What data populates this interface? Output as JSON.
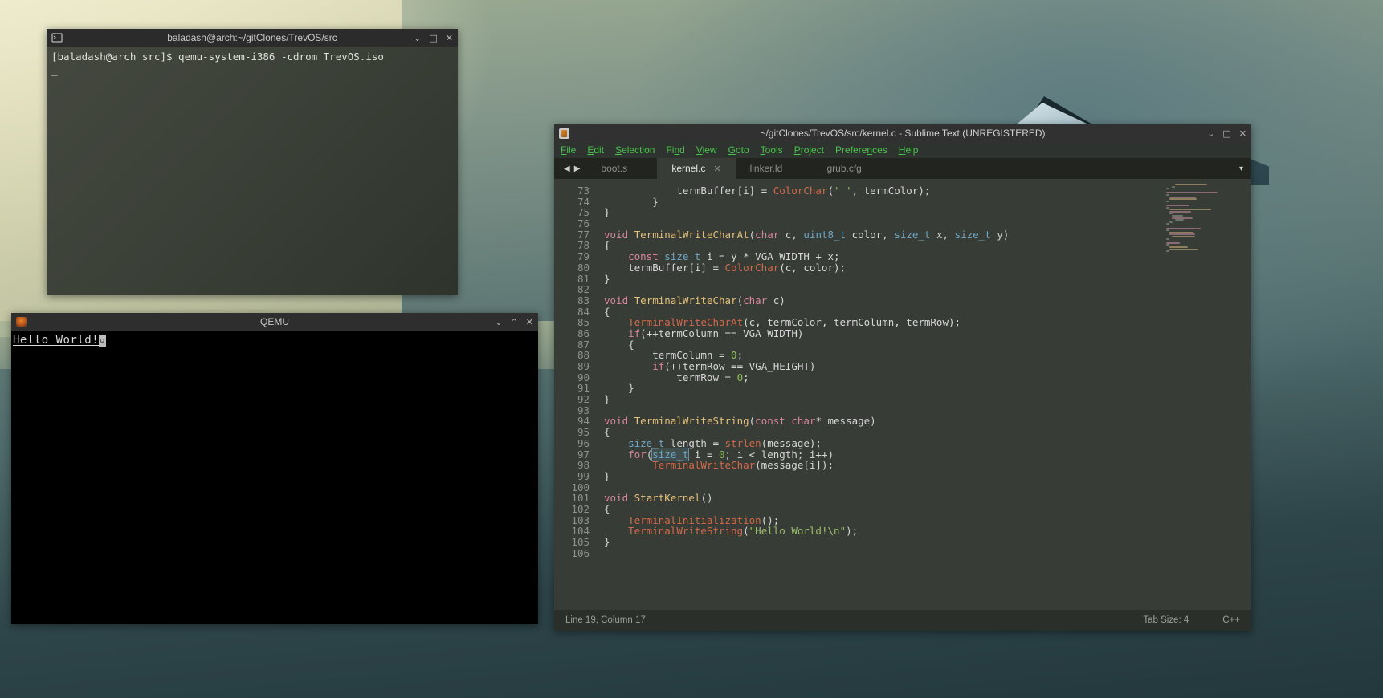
{
  "desktop": {
    "name": "desktop-wallpaper"
  },
  "terminal": {
    "title": "baladash@arch:~/gitClones/TrevOS/src",
    "icon": "terminal-icon",
    "buttons": {
      "minimize": "⌄",
      "maximize": "□",
      "close": "✕"
    },
    "lines": [
      "[baladash@arch src]$ qemu-system-i386 -cdrom TrevOS.iso"
    ],
    "cursor": "_"
  },
  "qemu": {
    "title": "QEMU",
    "icon": "qemu-logo-icon",
    "buttons": {
      "minimize": "⌄",
      "maximize": "⌃",
      "close": "✕"
    },
    "output_text": "Hello World!",
    "cursor_glyph": "▫"
  },
  "sublime": {
    "title": "~/gitClones/TrevOS/src/kernel.c - Sublime Text (UNREGISTERED)",
    "icon": "sublime-text-icon",
    "buttons": {
      "minimize": "⌄",
      "maximize": "□",
      "close": "✕"
    },
    "menu": [
      {
        "pre": "",
        "accel": "F",
        "post": "ile"
      },
      {
        "pre": "",
        "accel": "E",
        "post": "dit"
      },
      {
        "pre": "",
        "accel": "S",
        "post": "election"
      },
      {
        "pre": "Fi",
        "accel": "n",
        "post": "d"
      },
      {
        "pre": "",
        "accel": "V",
        "post": "iew"
      },
      {
        "pre": "",
        "accel": "G",
        "post": "oto"
      },
      {
        "pre": "",
        "accel": "T",
        "post": "ools"
      },
      {
        "pre": "",
        "accel": "P",
        "post": "roject"
      },
      {
        "pre": "Prefere",
        "accel": "n",
        "post": "ces"
      },
      {
        "pre": "",
        "accel": "H",
        "post": "elp"
      }
    ],
    "tab_nav": {
      "prev": "◀",
      "next": "▶"
    },
    "tabs": [
      {
        "label": "boot.s",
        "active": false,
        "close": "✕"
      },
      {
        "label": "kernel.c",
        "active": true,
        "close": "✕"
      },
      {
        "label": "linker.ld",
        "active": false,
        "close": "✕"
      },
      {
        "label": "grub.cfg",
        "active": false,
        "close": "✕"
      }
    ],
    "tabbar_menu_icon": "▾",
    "statusbar": {
      "position": "Line 19, Column 17",
      "tab_size": "Tab Size: 4",
      "syntax": "C++"
    },
    "first_line_number": 73,
    "code": [
      {
        "n": 73,
        "tokens": [
          {
            "t": "plain",
            "v": "            termBuffer[i] = "
          },
          {
            "t": "call",
            "v": "ColorChar"
          },
          {
            "t": "plain",
            "v": "("
          },
          {
            "t": "str",
            "v": "' '"
          },
          {
            "t": "plain",
            "v": ", termColor);"
          }
        ]
      },
      {
        "n": 74,
        "tokens": [
          {
            "t": "plain",
            "v": "        }"
          }
        ]
      },
      {
        "n": 75,
        "tokens": [
          {
            "t": "plain",
            "v": "}"
          }
        ]
      },
      {
        "n": 76,
        "tokens": [
          {
            "t": "plain",
            "v": ""
          }
        ]
      },
      {
        "n": 77,
        "tokens": [
          {
            "t": "kw",
            "v": "void"
          },
          {
            "t": "plain",
            "v": " "
          },
          {
            "t": "fn",
            "v": "TerminalWriteCharAt"
          },
          {
            "t": "plain",
            "v": "("
          },
          {
            "t": "kw",
            "v": "char"
          },
          {
            "t": "plain",
            "v": " c, "
          },
          {
            "t": "type",
            "v": "uint8_t"
          },
          {
            "t": "plain",
            "v": " color, "
          },
          {
            "t": "type",
            "v": "size_t"
          },
          {
            "t": "plain",
            "v": " x, "
          },
          {
            "t": "type",
            "v": "size_t"
          },
          {
            "t": "plain",
            "v": " y)"
          }
        ]
      },
      {
        "n": 78,
        "tokens": [
          {
            "t": "plain",
            "v": "{"
          }
        ]
      },
      {
        "n": 79,
        "tokens": [
          {
            "t": "plain",
            "v": "    "
          },
          {
            "t": "kw",
            "v": "const"
          },
          {
            "t": "plain",
            "v": " "
          },
          {
            "t": "type",
            "v": "size_t"
          },
          {
            "t": "plain",
            "v": " i = y * VGA_WIDTH + x;"
          }
        ]
      },
      {
        "n": 80,
        "tokens": [
          {
            "t": "plain",
            "v": "    termBuffer[i] = "
          },
          {
            "t": "call",
            "v": "ColorChar"
          },
          {
            "t": "plain",
            "v": "(c, color);"
          }
        ]
      },
      {
        "n": 81,
        "tokens": [
          {
            "t": "plain",
            "v": "}"
          }
        ]
      },
      {
        "n": 82,
        "tokens": [
          {
            "t": "plain",
            "v": ""
          }
        ]
      },
      {
        "n": 83,
        "tokens": [
          {
            "t": "kw",
            "v": "void"
          },
          {
            "t": "plain",
            "v": " "
          },
          {
            "t": "fn",
            "v": "TerminalWriteChar"
          },
          {
            "t": "plain",
            "v": "("
          },
          {
            "t": "kw",
            "v": "char"
          },
          {
            "t": "plain",
            "v": " c)"
          }
        ]
      },
      {
        "n": 84,
        "tokens": [
          {
            "t": "plain",
            "v": "{"
          }
        ]
      },
      {
        "n": 85,
        "tokens": [
          {
            "t": "plain",
            "v": "    "
          },
          {
            "t": "call",
            "v": "TerminalWriteCharAt"
          },
          {
            "t": "plain",
            "v": "(c, termColor, termColumn, termRow);"
          }
        ]
      },
      {
        "n": 86,
        "tokens": [
          {
            "t": "plain",
            "v": "    "
          },
          {
            "t": "kw",
            "v": "if"
          },
          {
            "t": "plain",
            "v": "(++termColumn == VGA_WIDTH)"
          }
        ]
      },
      {
        "n": 87,
        "tokens": [
          {
            "t": "plain",
            "v": "    {"
          }
        ]
      },
      {
        "n": 88,
        "tokens": [
          {
            "t": "plain",
            "v": "        termColumn = "
          },
          {
            "t": "num",
            "v": "0"
          },
          {
            "t": "plain",
            "v": ";"
          }
        ]
      },
      {
        "n": 89,
        "tokens": [
          {
            "t": "plain",
            "v": "        "
          },
          {
            "t": "kw",
            "v": "if"
          },
          {
            "t": "plain",
            "v": "(++termRow == VGA_HEIGHT)"
          }
        ]
      },
      {
        "n": 90,
        "tokens": [
          {
            "t": "plain",
            "v": "            termRow = "
          },
          {
            "t": "num",
            "v": "0"
          },
          {
            "t": "plain",
            "v": ";"
          }
        ]
      },
      {
        "n": 91,
        "tokens": [
          {
            "t": "plain",
            "v": "    }"
          }
        ]
      },
      {
        "n": 92,
        "tokens": [
          {
            "t": "plain",
            "v": "}"
          }
        ]
      },
      {
        "n": 93,
        "tokens": [
          {
            "t": "plain",
            "v": ""
          }
        ]
      },
      {
        "n": 94,
        "tokens": [
          {
            "t": "kw",
            "v": "void"
          },
          {
            "t": "plain",
            "v": " "
          },
          {
            "t": "fn",
            "v": "TerminalWriteString"
          },
          {
            "t": "plain",
            "v": "("
          },
          {
            "t": "kw",
            "v": "const char"
          },
          {
            "t": "plain",
            "v": "* message)"
          }
        ]
      },
      {
        "n": 95,
        "tokens": [
          {
            "t": "plain",
            "v": "{"
          }
        ]
      },
      {
        "n": 96,
        "tokens": [
          {
            "t": "plain",
            "v": "    "
          },
          {
            "t": "type",
            "v": "size_t"
          },
          {
            "t": "plain",
            "v": " length = "
          },
          {
            "t": "call",
            "v": "strlen"
          },
          {
            "t": "plain",
            "v": "(message);"
          }
        ]
      },
      {
        "n": 97,
        "tokens": [
          {
            "t": "plain",
            "v": "    "
          },
          {
            "t": "kw",
            "v": "for"
          },
          {
            "t": "plain",
            "v": "("
          },
          {
            "t": "sel",
            "v": "size_t"
          },
          {
            "t": "plain",
            "v": " i = "
          },
          {
            "t": "num",
            "v": "0"
          },
          {
            "t": "plain",
            "v": "; i < length; i++)"
          }
        ]
      },
      {
        "n": 98,
        "tokens": [
          {
            "t": "plain",
            "v": "        "
          },
          {
            "t": "call",
            "v": "TerminalWriteChar"
          },
          {
            "t": "plain",
            "v": "(message[i]);"
          }
        ]
      },
      {
        "n": 99,
        "tokens": [
          {
            "t": "plain",
            "v": "}"
          }
        ]
      },
      {
        "n": 100,
        "tokens": [
          {
            "t": "plain",
            "v": ""
          }
        ]
      },
      {
        "n": 101,
        "tokens": [
          {
            "t": "kw",
            "v": "void"
          },
          {
            "t": "plain",
            "v": " "
          },
          {
            "t": "fn",
            "v": "StartKernel"
          },
          {
            "t": "plain",
            "v": "()"
          }
        ]
      },
      {
        "n": 102,
        "tokens": [
          {
            "t": "plain",
            "v": "{"
          }
        ]
      },
      {
        "n": 103,
        "tokens": [
          {
            "t": "plain",
            "v": "    "
          },
          {
            "t": "call",
            "v": "TerminalInitialization"
          },
          {
            "t": "plain",
            "v": "();"
          }
        ]
      },
      {
        "n": 104,
        "tokens": [
          {
            "t": "plain",
            "v": "    "
          },
          {
            "t": "call",
            "v": "TerminalWriteString"
          },
          {
            "t": "plain",
            "v": "("
          },
          {
            "t": "str",
            "v": "\"Hello World!\\n\""
          },
          {
            "t": "plain",
            "v": ");"
          }
        ]
      },
      {
        "n": 105,
        "tokens": [
          {
            "t": "plain",
            "v": "}"
          }
        ]
      },
      {
        "n": 106,
        "tokens": [
          {
            "t": "plain",
            "v": ""
          }
        ]
      }
    ],
    "colors": {
      "keyword": "#d9869b",
      "function_def": "#e5c07b",
      "function_call": "#d4694a",
      "type": "#6fa8c7",
      "number": "#8fbf5f",
      "string": "#9bbf6a",
      "editor_bg": "#373c36",
      "menu_text": "#49c24c"
    }
  }
}
